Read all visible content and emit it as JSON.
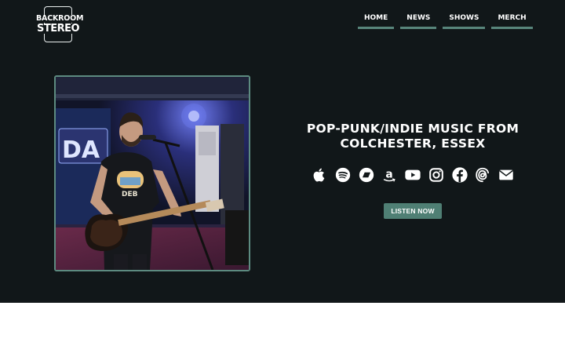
{
  "brand": {
    "logo_line1": "BACKROOM",
    "logo_line2": "STEREO"
  },
  "nav": [
    {
      "label": "HOME"
    },
    {
      "label": "NEWS"
    },
    {
      "label": "SHOWS"
    },
    {
      "label": "MERCH"
    }
  ],
  "hero": {
    "headline_line1": "POP-PUNK/INDIE MUSIC FROM",
    "headline_line2": "COLCHESTER, ESSEX",
    "cta_label": "LISTEN NOW",
    "photo_text": "DA"
  },
  "social": [
    {
      "icon": "apple-music-icon"
    },
    {
      "icon": "spotify-icon"
    },
    {
      "icon": "bandcamp-icon"
    },
    {
      "icon": "amazon-music-icon"
    },
    {
      "icon": "youtube-icon"
    },
    {
      "icon": "instagram-icon"
    },
    {
      "icon": "facebook-icon"
    },
    {
      "icon": "threads-icon"
    },
    {
      "icon": "email-icon"
    }
  ],
  "colors": {
    "background": "#111719",
    "accent": "#4f7f74",
    "text": "#ffffff"
  }
}
